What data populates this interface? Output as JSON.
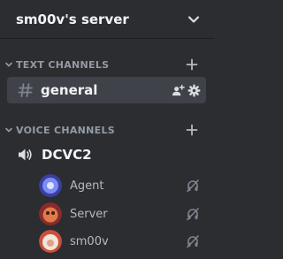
{
  "header": {
    "server_name": "sm00v's server"
  },
  "categories": [
    {
      "label": "TEXT CHANNELS"
    },
    {
      "label": "VOICE CHANNELS"
    }
  ],
  "text_channels": [
    {
      "name": "general",
      "selected": true
    }
  ],
  "voice_channels": [
    {
      "name": "DCVC2",
      "members": [
        {
          "name": "Agent",
          "avatar_colors": [
            "#7d8cf2",
            "#3a3fa0"
          ]
        },
        {
          "name": "Server",
          "avatar_colors": [
            "#e07a4a",
            "#8a2b2b"
          ]
        },
        {
          "name": "sm00v",
          "avatar_colors": [
            "#f0e6d8",
            "#c8503c"
          ]
        }
      ]
    }
  ],
  "icons": {
    "header": "chevron-down-icon",
    "category": "caret-down-icon",
    "add": "plus-icon",
    "text_channel": "hash-icon",
    "invite": "add-user-icon",
    "settings": "gear-icon",
    "voice_channel": "speaker-icon",
    "member_status": "deafened-icon"
  },
  "colors": {
    "background": "#2b2d31",
    "selected": "#404249",
    "text_primary": "#f2f3f5",
    "text_muted": "#949ba4",
    "member_text": "#b5bac1"
  }
}
